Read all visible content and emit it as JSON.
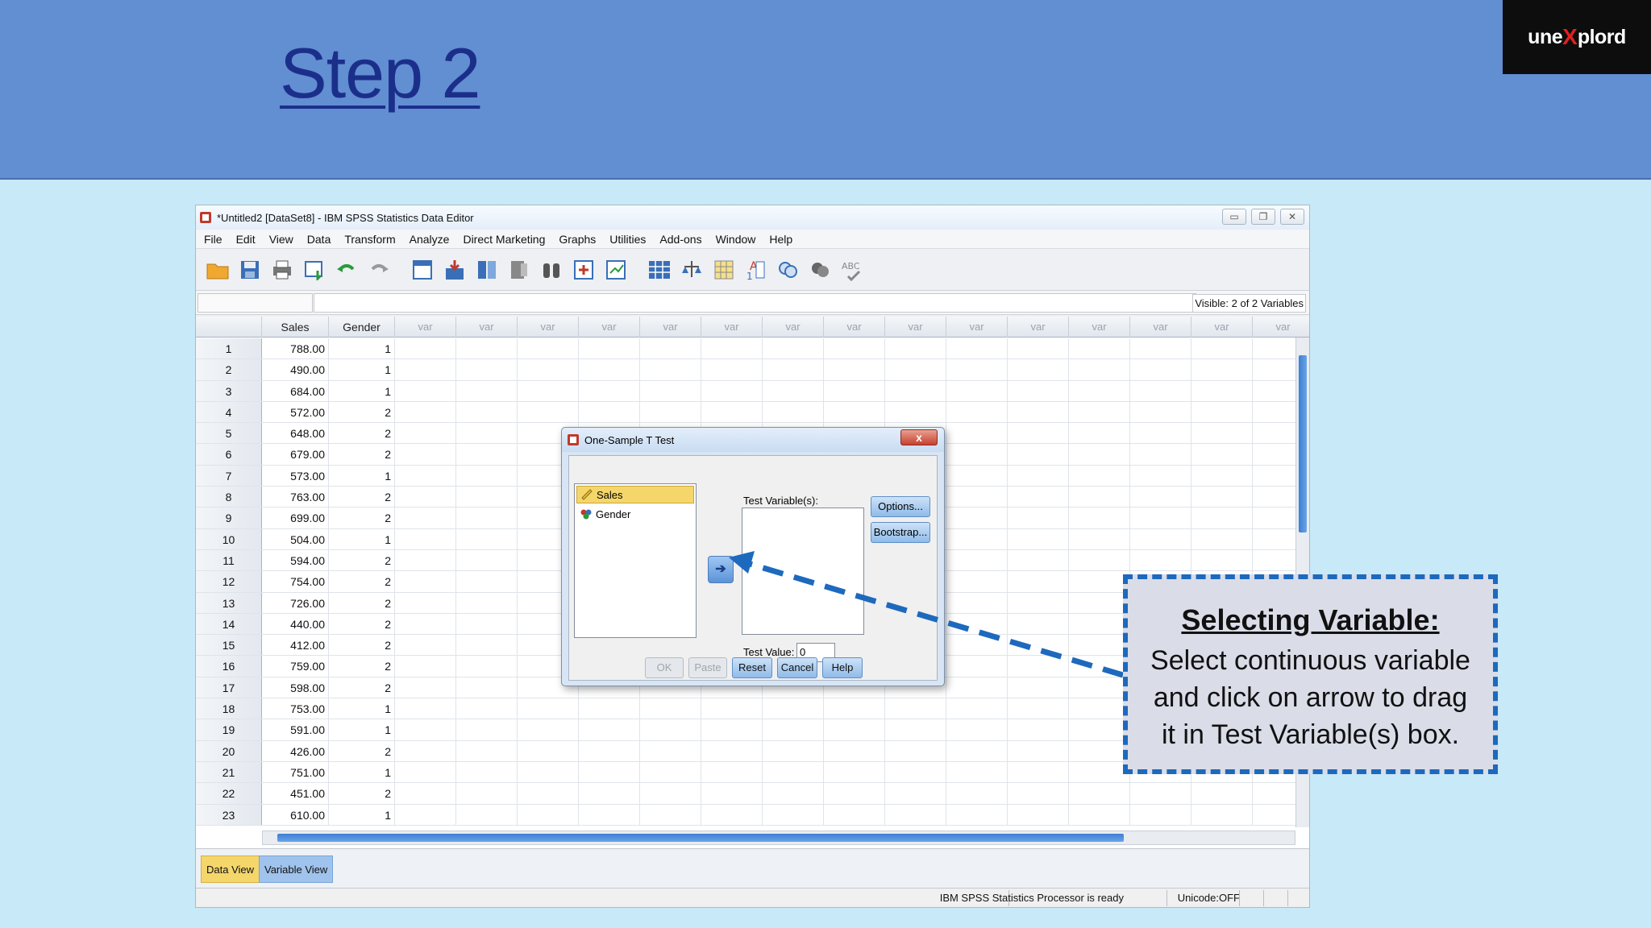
{
  "slide": {
    "title": "Step 2",
    "logo_left": "une",
    "logo_x": "X",
    "logo_right": "plord"
  },
  "window": {
    "title": "*Untitled2 [DataSet8] - IBM SPSS Statistics Data Editor",
    "menu": [
      "File",
      "Edit",
      "View",
      "Data",
      "Transform",
      "Analyze",
      "Direct Marketing",
      "Graphs",
      "Utilities",
      "Add-ons",
      "Window",
      "Help"
    ],
    "visible_info": "Visible: 2 of 2 Variables",
    "columns": [
      "Sales",
      "Gender"
    ],
    "var_label": "var",
    "rows": [
      [
        "1",
        "788.00",
        "1"
      ],
      [
        "2",
        "490.00",
        "1"
      ],
      [
        "3",
        "684.00",
        "1"
      ],
      [
        "4",
        "572.00",
        "2"
      ],
      [
        "5",
        "648.00",
        "2"
      ],
      [
        "6",
        "679.00",
        "2"
      ],
      [
        "7",
        "573.00",
        "1"
      ],
      [
        "8",
        "763.00",
        "2"
      ],
      [
        "9",
        "699.00",
        "2"
      ],
      [
        "10",
        "504.00",
        "1"
      ],
      [
        "11",
        "594.00",
        "2"
      ],
      [
        "12",
        "754.00",
        "2"
      ],
      [
        "13",
        "726.00",
        "2"
      ],
      [
        "14",
        "440.00",
        "2"
      ],
      [
        "15",
        "412.00",
        "2"
      ],
      [
        "16",
        "759.00",
        "2"
      ],
      [
        "17",
        "598.00",
        "2"
      ],
      [
        "18",
        "753.00",
        "1"
      ],
      [
        "19",
        "591.00",
        "1"
      ],
      [
        "20",
        "426.00",
        "2"
      ],
      [
        "21",
        "751.00",
        "1"
      ],
      [
        "22",
        "451.00",
        "2"
      ],
      [
        "23",
        "610.00",
        "1"
      ]
    ],
    "tabs": {
      "data_view": "Data View",
      "variable_view": "Variable View"
    },
    "status": "IBM SPSS Statistics Processor is ready",
    "unicode": "Unicode:OFF"
  },
  "dialog": {
    "title": "One-Sample T Test",
    "close": "x",
    "variables": [
      "Sales",
      "Gender"
    ],
    "test_variables_label": "Test Variable(s):",
    "options_label": "Options...",
    "bootstrap_label": "Bootstrap...",
    "test_value_label": "Test Value:",
    "test_value": "0",
    "buttons": {
      "ok": "OK",
      "paste": "Paste",
      "reset": "Reset",
      "cancel": "Cancel",
      "help": "Help"
    }
  },
  "callout": {
    "title": "Selecting Variable:",
    "line1": "Select continuous variable",
    "line2": "and click on arrow to drag",
    "line3": "it in Test Variable(s) box."
  },
  "colors": {
    "header_bg": "#628ed2",
    "title": "#1b2f8a",
    "accent_blue": "#1d69bd",
    "selected": "#f5d66b"
  }
}
